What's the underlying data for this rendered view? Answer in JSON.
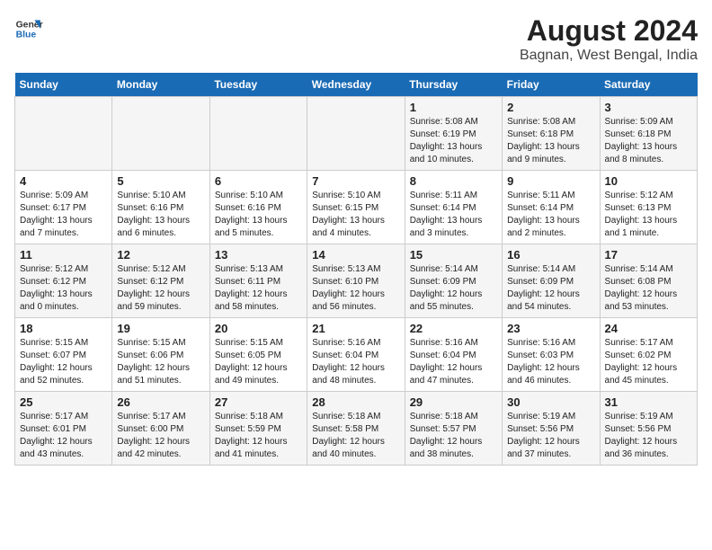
{
  "header": {
    "logo_line1": "General",
    "logo_line2": "Blue",
    "title": "August 2024",
    "subtitle": "Bagnan, West Bengal, India"
  },
  "weekdays": [
    "Sunday",
    "Monday",
    "Tuesday",
    "Wednesday",
    "Thursday",
    "Friday",
    "Saturday"
  ],
  "weeks": [
    [
      {
        "day": "",
        "info": ""
      },
      {
        "day": "",
        "info": ""
      },
      {
        "day": "",
        "info": ""
      },
      {
        "day": "",
        "info": ""
      },
      {
        "day": "1",
        "info": "Sunrise: 5:08 AM\nSunset: 6:19 PM\nDaylight: 13 hours\nand 10 minutes."
      },
      {
        "day": "2",
        "info": "Sunrise: 5:08 AM\nSunset: 6:18 PM\nDaylight: 13 hours\nand 9 minutes."
      },
      {
        "day": "3",
        "info": "Sunrise: 5:09 AM\nSunset: 6:18 PM\nDaylight: 13 hours\nand 8 minutes."
      }
    ],
    [
      {
        "day": "4",
        "info": "Sunrise: 5:09 AM\nSunset: 6:17 PM\nDaylight: 13 hours\nand 7 minutes."
      },
      {
        "day": "5",
        "info": "Sunrise: 5:10 AM\nSunset: 6:16 PM\nDaylight: 13 hours\nand 6 minutes."
      },
      {
        "day": "6",
        "info": "Sunrise: 5:10 AM\nSunset: 6:16 PM\nDaylight: 13 hours\nand 5 minutes."
      },
      {
        "day": "7",
        "info": "Sunrise: 5:10 AM\nSunset: 6:15 PM\nDaylight: 13 hours\nand 4 minutes."
      },
      {
        "day": "8",
        "info": "Sunrise: 5:11 AM\nSunset: 6:14 PM\nDaylight: 13 hours\nand 3 minutes."
      },
      {
        "day": "9",
        "info": "Sunrise: 5:11 AM\nSunset: 6:14 PM\nDaylight: 13 hours\nand 2 minutes."
      },
      {
        "day": "10",
        "info": "Sunrise: 5:12 AM\nSunset: 6:13 PM\nDaylight: 13 hours\nand 1 minute."
      }
    ],
    [
      {
        "day": "11",
        "info": "Sunrise: 5:12 AM\nSunset: 6:12 PM\nDaylight: 13 hours\nand 0 minutes."
      },
      {
        "day": "12",
        "info": "Sunrise: 5:12 AM\nSunset: 6:12 PM\nDaylight: 12 hours\nand 59 minutes."
      },
      {
        "day": "13",
        "info": "Sunrise: 5:13 AM\nSunset: 6:11 PM\nDaylight: 12 hours\nand 58 minutes."
      },
      {
        "day": "14",
        "info": "Sunrise: 5:13 AM\nSunset: 6:10 PM\nDaylight: 12 hours\nand 56 minutes."
      },
      {
        "day": "15",
        "info": "Sunrise: 5:14 AM\nSunset: 6:09 PM\nDaylight: 12 hours\nand 55 minutes."
      },
      {
        "day": "16",
        "info": "Sunrise: 5:14 AM\nSunset: 6:09 PM\nDaylight: 12 hours\nand 54 minutes."
      },
      {
        "day": "17",
        "info": "Sunrise: 5:14 AM\nSunset: 6:08 PM\nDaylight: 12 hours\nand 53 minutes."
      }
    ],
    [
      {
        "day": "18",
        "info": "Sunrise: 5:15 AM\nSunset: 6:07 PM\nDaylight: 12 hours\nand 52 minutes."
      },
      {
        "day": "19",
        "info": "Sunrise: 5:15 AM\nSunset: 6:06 PM\nDaylight: 12 hours\nand 51 minutes."
      },
      {
        "day": "20",
        "info": "Sunrise: 5:15 AM\nSunset: 6:05 PM\nDaylight: 12 hours\nand 49 minutes."
      },
      {
        "day": "21",
        "info": "Sunrise: 5:16 AM\nSunset: 6:04 PM\nDaylight: 12 hours\nand 48 minutes."
      },
      {
        "day": "22",
        "info": "Sunrise: 5:16 AM\nSunset: 6:04 PM\nDaylight: 12 hours\nand 47 minutes."
      },
      {
        "day": "23",
        "info": "Sunrise: 5:16 AM\nSunset: 6:03 PM\nDaylight: 12 hours\nand 46 minutes."
      },
      {
        "day": "24",
        "info": "Sunrise: 5:17 AM\nSunset: 6:02 PM\nDaylight: 12 hours\nand 45 minutes."
      }
    ],
    [
      {
        "day": "25",
        "info": "Sunrise: 5:17 AM\nSunset: 6:01 PM\nDaylight: 12 hours\nand 43 minutes."
      },
      {
        "day": "26",
        "info": "Sunrise: 5:17 AM\nSunset: 6:00 PM\nDaylight: 12 hours\nand 42 minutes."
      },
      {
        "day": "27",
        "info": "Sunrise: 5:18 AM\nSunset: 5:59 PM\nDaylight: 12 hours\nand 41 minutes."
      },
      {
        "day": "28",
        "info": "Sunrise: 5:18 AM\nSunset: 5:58 PM\nDaylight: 12 hours\nand 40 minutes."
      },
      {
        "day": "29",
        "info": "Sunrise: 5:18 AM\nSunset: 5:57 PM\nDaylight: 12 hours\nand 38 minutes."
      },
      {
        "day": "30",
        "info": "Sunrise: 5:19 AM\nSunset: 5:56 PM\nDaylight: 12 hours\nand 37 minutes."
      },
      {
        "day": "31",
        "info": "Sunrise: 5:19 AM\nSunset: 5:56 PM\nDaylight: 12 hours\nand 36 minutes."
      }
    ]
  ]
}
